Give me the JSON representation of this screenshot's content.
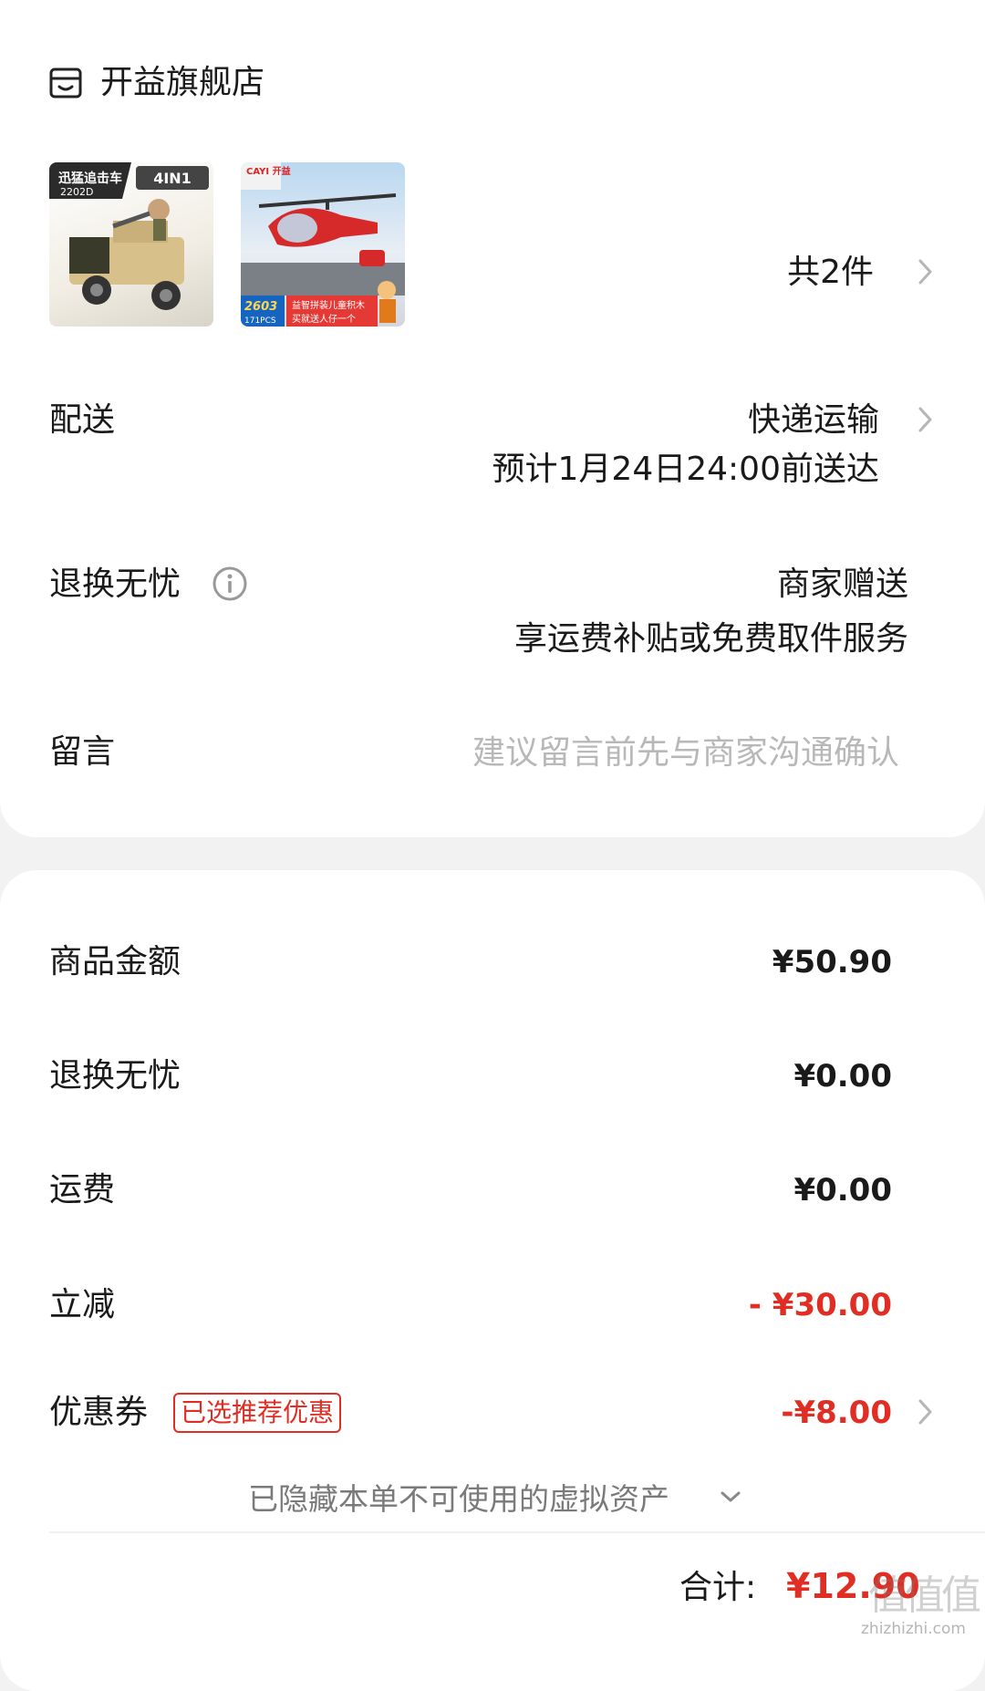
{
  "store": {
    "name": "开益旗舰店",
    "icon": "store-icon"
  },
  "items": {
    "count_label": "共2件",
    "thumbs": [
      {
        "title": "迅猛追击车",
        "code": "2202D",
        "badge": "4IN1"
      },
      {
        "brand": "CAYI 开益",
        "code": "2603",
        "pcs": "171PCS",
        "caption1": "益智拼装儿童积木",
        "caption2": "买就送人仔一个"
      }
    ]
  },
  "delivery": {
    "label": "配送",
    "method": "快递运输",
    "eta": "预计1月24日24:00前送达"
  },
  "returns": {
    "label": "退换无忧",
    "provider": "商家赠送",
    "desc": "享运费补贴或免费取件服务"
  },
  "message": {
    "label": "留言",
    "placeholder": "建议留言前先与商家沟通确认"
  },
  "summary": {
    "goods_label": "商品金额",
    "goods_value": "¥50.90",
    "returns_label": "退换无忧",
    "returns_value": "¥0.00",
    "shipping_label": "运费",
    "shipping_value": "¥0.00",
    "discount_label": "立减",
    "discount_value": "- ¥30.00",
    "coupon_label": "优惠券",
    "coupon_badge": "已选推荐优惠",
    "coupon_value": "-¥8.00",
    "hidden_assets": "已隐藏本单不可使用的虚拟资产",
    "total_label": "合计:",
    "total_value": "¥12.90"
  },
  "watermark": {
    "url": "zhizhizhi.com",
    "logo": "值值值"
  },
  "colors": {
    "accent": "#e02e24",
    "text": "#1a1a1a",
    "muted": "#7a7a7a",
    "placeholder": "#b8b8b8"
  }
}
